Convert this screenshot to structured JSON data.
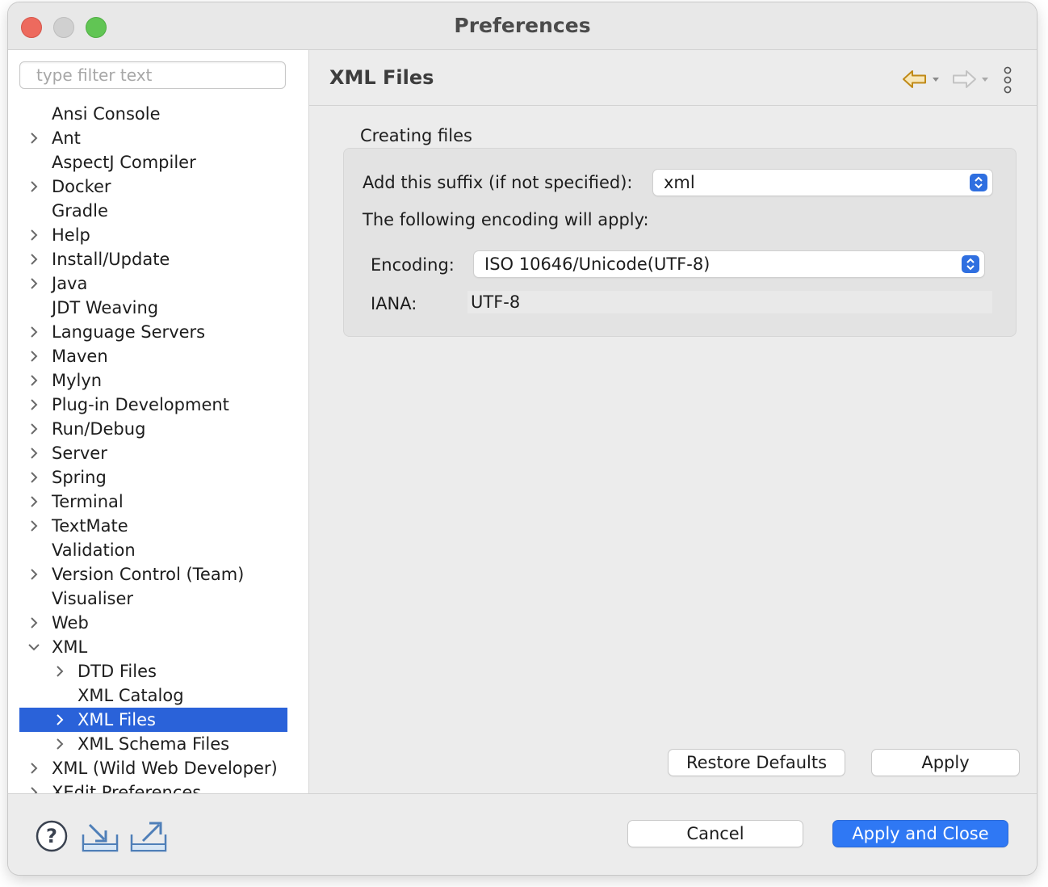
{
  "window": {
    "title": "Preferences"
  },
  "filter": {
    "placeholder": "type filter text"
  },
  "tree": [
    {
      "label": "Ansi Console",
      "level": 0,
      "expander": "none"
    },
    {
      "label": "Ant",
      "level": 0,
      "expander": "collapsed"
    },
    {
      "label": "AspectJ Compiler",
      "level": 0,
      "expander": "none"
    },
    {
      "label": "Docker",
      "level": 0,
      "expander": "collapsed"
    },
    {
      "label": "Gradle",
      "level": 0,
      "expander": "none"
    },
    {
      "label": "Help",
      "level": 0,
      "expander": "collapsed"
    },
    {
      "label": "Install/Update",
      "level": 0,
      "expander": "collapsed"
    },
    {
      "label": "Java",
      "level": 0,
      "expander": "collapsed"
    },
    {
      "label": "JDT Weaving",
      "level": 0,
      "expander": "none"
    },
    {
      "label": "Language Servers",
      "level": 0,
      "expander": "collapsed"
    },
    {
      "label": "Maven",
      "level": 0,
      "expander": "collapsed"
    },
    {
      "label": "Mylyn",
      "level": 0,
      "expander": "collapsed"
    },
    {
      "label": "Plug-in Development",
      "level": 0,
      "expander": "collapsed"
    },
    {
      "label": "Run/Debug",
      "level": 0,
      "expander": "collapsed"
    },
    {
      "label": "Server",
      "level": 0,
      "expander": "collapsed"
    },
    {
      "label": "Spring",
      "level": 0,
      "expander": "collapsed"
    },
    {
      "label": "Terminal",
      "level": 0,
      "expander": "collapsed"
    },
    {
      "label": "TextMate",
      "level": 0,
      "expander": "collapsed"
    },
    {
      "label": "Validation",
      "level": 0,
      "expander": "none"
    },
    {
      "label": "Version Control (Team)",
      "level": 0,
      "expander": "collapsed"
    },
    {
      "label": "Visualiser",
      "level": 0,
      "expander": "none"
    },
    {
      "label": "Web",
      "level": 0,
      "expander": "collapsed"
    },
    {
      "label": "XML",
      "level": 0,
      "expander": "expanded"
    },
    {
      "label": "DTD Files",
      "level": 1,
      "expander": "collapsed"
    },
    {
      "label": "XML Catalog",
      "level": 1,
      "expander": "none"
    },
    {
      "label": "XML Files",
      "level": 1,
      "expander": "collapsed",
      "selected": true
    },
    {
      "label": "XML Schema Files",
      "level": 1,
      "expander": "collapsed"
    },
    {
      "label": "XML (Wild Web Developer)",
      "level": 0,
      "expander": "collapsed"
    },
    {
      "label": "XEdit Preferences",
      "level": 0,
      "expander": "collapsed"
    }
  ],
  "page": {
    "title": "XML Files",
    "nav": {
      "back_icon": "back-arrow-icon",
      "forward_icon": "forward-arrow-icon",
      "menu_icon": "view-menu-icon"
    },
    "creating_files": {
      "section_label": "Creating files",
      "suffix_label": "Add this suffix (if not specified):",
      "suffix_value": "xml",
      "encoding_note": "The following encoding will apply:",
      "encoding_label": "Encoding:",
      "encoding_value": "ISO 10646/Unicode(UTF-8)",
      "iana_label": "IANA:",
      "iana_value": "UTF-8"
    },
    "restore_defaults_label": "Restore Defaults",
    "apply_label": "Apply"
  },
  "footer": {
    "help_icon": "help-icon",
    "import_icon": "import-icon",
    "export_icon": "export-icon",
    "cancel_label": "Cancel",
    "apply_close_label": "Apply and Close"
  },
  "colors": {
    "selection": "#2a62d9",
    "primary_button": "#2f78f4",
    "stepper": "#2f6fe0",
    "close": "#ed6a5e",
    "minimize": "#d0d0d0",
    "maximize": "#61c554"
  }
}
